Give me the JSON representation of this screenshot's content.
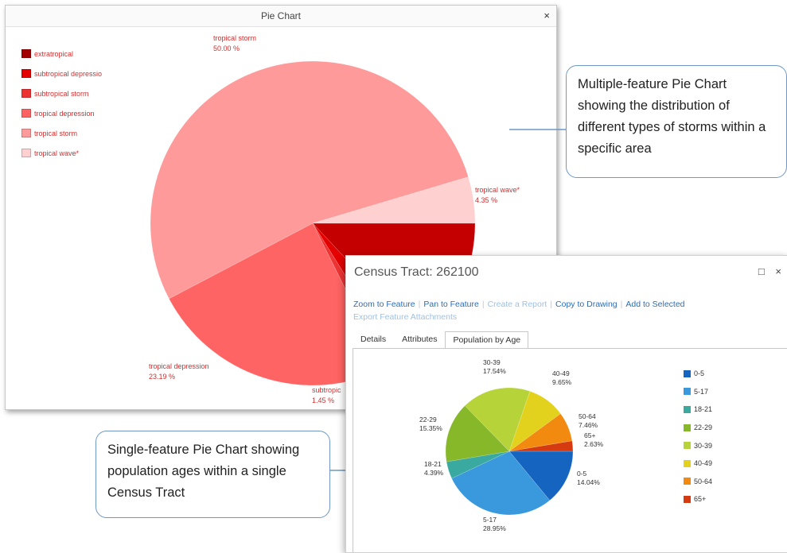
{
  "colors": {
    "callout_border": "#6f98c2",
    "link": "#2a6ebb",
    "link_disabled": "#9fc1e4"
  },
  "window1": {
    "title": "Pie Chart",
    "close_icon": "close-icon",
    "legend": [
      {
        "label": "extratropical",
        "color": "#a50000"
      },
      {
        "label": "subtropical depressio",
        "color": "#e40000"
      },
      {
        "label": "subtropical storm",
        "color": "#ee3333"
      },
      {
        "label": "tropical depression",
        "color": "#ff6464"
      },
      {
        "label": "tropical storm",
        "color": "#ff9a9a"
      },
      {
        "label": "tropical wave*",
        "color": "#ffd0d0"
      }
    ]
  },
  "callouts": {
    "multi": "Multiple-feature Pie Chart showing the distribution of different types of storms within a specific area",
    "single": "Single-feature Pie Chart showing population ages within a single Census Tract"
  },
  "window2": {
    "title": "Census Tract: 262100",
    "restore_icon": "□",
    "close_icon": "×",
    "actions": {
      "zoom": "Zoom to Feature",
      "pan": "Pan to Feature",
      "report": "Create a Report",
      "copy": "Copy to Drawing",
      "add": "Add to Selected",
      "export": "Export Feature Attachments"
    },
    "tabs": {
      "details": "Details",
      "attributes": "Attributes",
      "population": "Population by Age"
    }
  },
  "chart_data": [
    {
      "type": "pie",
      "categories": [
        "extratropical",
        "subtropical depressio",
        "subtropical storm",
        "tropical depression",
        "tropical storm",
        "tropical wave*"
      ],
      "values": [
        12.3,
        2.9,
        1.45,
        23.19,
        50.0,
        4.35
      ],
      "slice_labels": [
        {
          "category": "tropical storm",
          "name": "tropical storm",
          "pct": "50.00 %"
        },
        {
          "category": "tropical wave*",
          "name": "tropical wave*",
          "pct": "4.35 %"
        },
        {
          "category": "tropical depression",
          "name": "tropical depression",
          "pct": "23.19 %"
        },
        {
          "category": "subtropical storm",
          "name": "subtropic",
          "pct": "1.45 %"
        }
      ],
      "colors": [
        "#c40000",
        "#e40000",
        "#ee3333",
        "#ff6464",
        "#ff9a9a",
        "#ffd0d0"
      ]
    },
    {
      "type": "pie",
      "categories": [
        "0-5",
        "5-17",
        "18-21",
        "22-29",
        "30-39",
        "40-49",
        "50-64",
        "65+"
      ],
      "values": [
        14.04,
        28.95,
        4.39,
        15.35,
        17.54,
        9.65,
        7.46,
        2.63
      ],
      "value_labels": [
        "14.04%",
        "28.95%",
        "4.39%",
        "15.35%",
        "17.54%",
        "9.65%",
        "7.46%",
        "2.63%"
      ],
      "colors": [
        "#1565c0",
        "#3a98dc",
        "#3aaaa0",
        "#86b82a",
        "#b6d43a",
        "#e2d21e",
        "#f28a10",
        "#d63a10"
      ]
    }
  ]
}
